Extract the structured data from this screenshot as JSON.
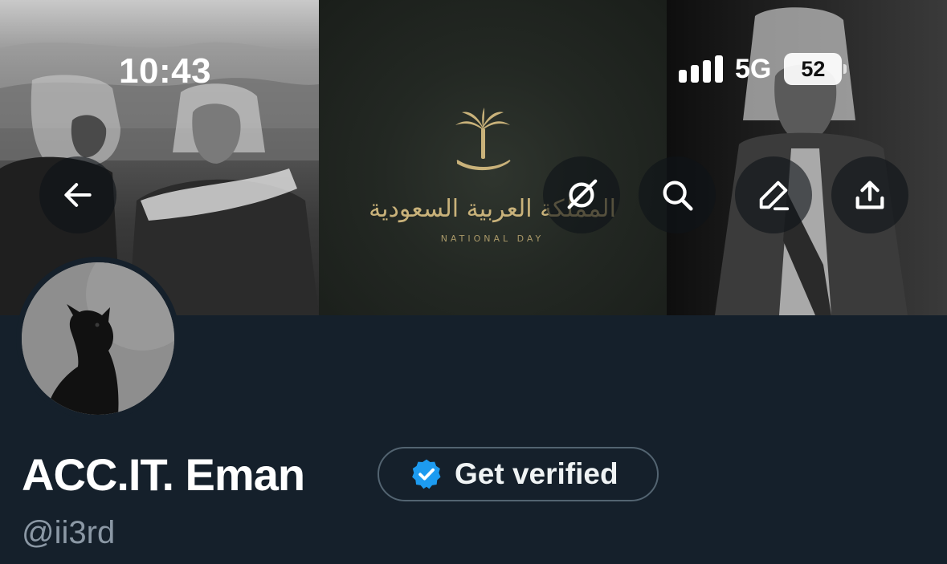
{
  "status_bar": {
    "time": "10:43",
    "network": "5G",
    "battery": "52"
  },
  "banner": {
    "emblem_text": "المملكة العربية السعودية",
    "emblem_subtitle": "NATIONAL DAY"
  },
  "header_buttons": {
    "back": "arrow-left-icon",
    "grok": "grok-icon",
    "search": "search-icon",
    "edit": "pencil-icon",
    "share": "share-icon"
  },
  "profile": {
    "display_name": "ACC.IT. Eman",
    "verify_button_label": "Get verified",
    "handle": "@ii3rd"
  },
  "colors": {
    "background": "#15202b",
    "accent_verified": "#1d9bf0",
    "secondary_text": "#8b98a5",
    "border": "#536471"
  }
}
